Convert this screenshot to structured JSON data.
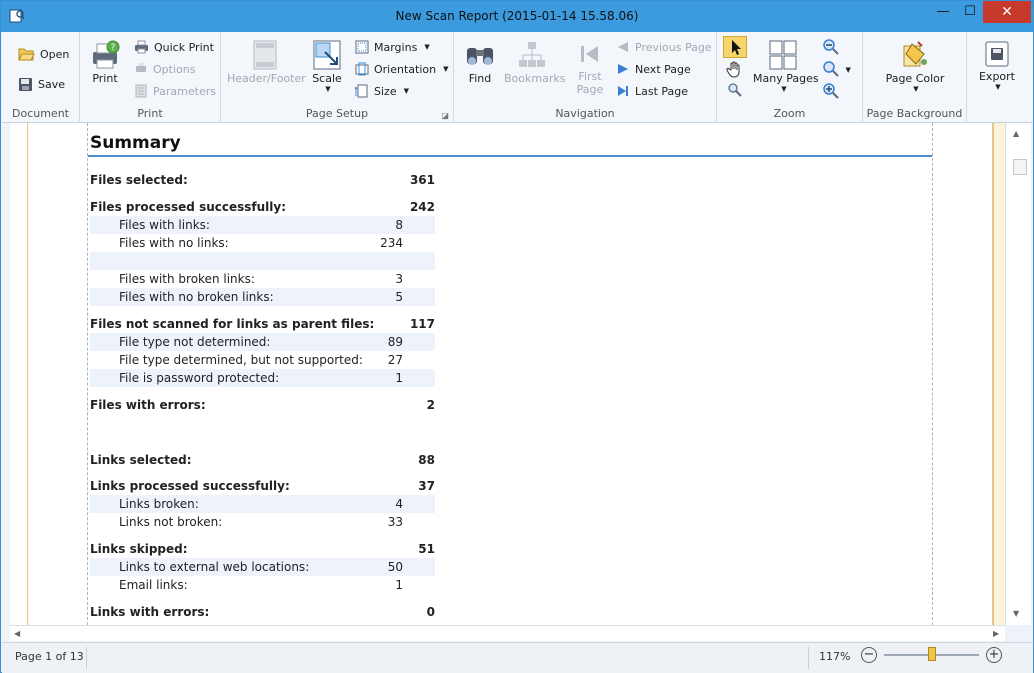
{
  "window": {
    "title": "New Scan Report (2015-01-14 15.58.06)",
    "min_glyph": "—",
    "max_glyph": "☐",
    "close_glyph": "✕"
  },
  "ribbon": {
    "document": {
      "label": "Document",
      "open": "Open",
      "save": "Save"
    },
    "print": {
      "label": "Print",
      "print": "Print",
      "quick_print": "Quick Print",
      "options": "Options",
      "parameters": "Parameters"
    },
    "page_setup": {
      "label": "Page Setup",
      "header_footer": "Header/Footer",
      "scale": "Scale",
      "margins": "Margins",
      "orientation": "Orientation",
      "size": "Size"
    },
    "navigation": {
      "label": "Navigation",
      "find": "Find",
      "bookmarks": "Bookmarks",
      "first_page_1": "First",
      "first_page_2": "Page",
      "previous_page": "Previous Page",
      "next_page": "Next Page",
      "last_page": "Last Page"
    },
    "zoom": {
      "label": "Zoom",
      "many_pages": "Many Pages"
    },
    "page_background": {
      "label": "Page Background",
      "page_color": "Page Color"
    },
    "export": {
      "export": "Export"
    }
  },
  "report": {
    "title": "Summary",
    "rows": [
      {
        "label": "Files selected:",
        "value": "361",
        "level": "top"
      },
      {
        "label": "Files processed successfully:",
        "value": "242",
        "level": "top"
      },
      {
        "label": "Files with links:",
        "value": "8",
        "level": "sub"
      },
      {
        "label": "Files with no links:",
        "value": "234",
        "level": "sub"
      },
      {
        "label": "",
        "value": "",
        "level": "sub"
      },
      {
        "label": "Files with broken links:",
        "value": "3",
        "level": "sub"
      },
      {
        "label": "Files with no broken links:",
        "value": "5",
        "level": "sub"
      },
      {
        "label": "Files not scanned for links as parent files:",
        "value": "117",
        "level": "top"
      },
      {
        "label": "File type not determined:",
        "value": "89",
        "level": "sub"
      },
      {
        "label": "File type determined, but not supported:",
        "value": "27",
        "level": "sub"
      },
      {
        "label": "File is password protected:",
        "value": "1",
        "level": "sub"
      },
      {
        "label": "Files with errors:",
        "value": "2",
        "level": "top"
      },
      {
        "label": "Links selected:",
        "value": "88",
        "level": "top"
      },
      {
        "label": "Links processed successfully:",
        "value": "37",
        "level": "top"
      },
      {
        "label": "Links broken:",
        "value": "4",
        "level": "sub"
      },
      {
        "label": "Links not broken:",
        "value": "33",
        "level": "sub"
      },
      {
        "label": "Links skipped:",
        "value": "51",
        "level": "top"
      },
      {
        "label": "Links to external web locations:",
        "value": "50",
        "level": "sub"
      },
      {
        "label": "Email links:",
        "value": "1",
        "level": "sub"
      },
      {
        "label": "Links with errors:",
        "value": "0",
        "level": "top"
      }
    ]
  },
  "status": {
    "page": "Page 1 of 13",
    "zoom": "117%",
    "zoom_level_percent": 51,
    "zoom_out": "−",
    "zoom_in": "+"
  },
  "colors": {
    "titlebar": "#3c9bdf",
    "close": "#c7392b",
    "accent_rule": "#4a8fd4",
    "row_shade": "#eef2fa"
  },
  "icons": {
    "app": "app-icon",
    "open": "folder-open-icon",
    "save": "floppy-disk-icon",
    "print": "printer-icon",
    "find": "binoculars-icon",
    "bookmarks": "bookmarks-tree-icon",
    "pointer": "pointer-icon",
    "hand": "hand-icon",
    "export": "export-icon"
  }
}
